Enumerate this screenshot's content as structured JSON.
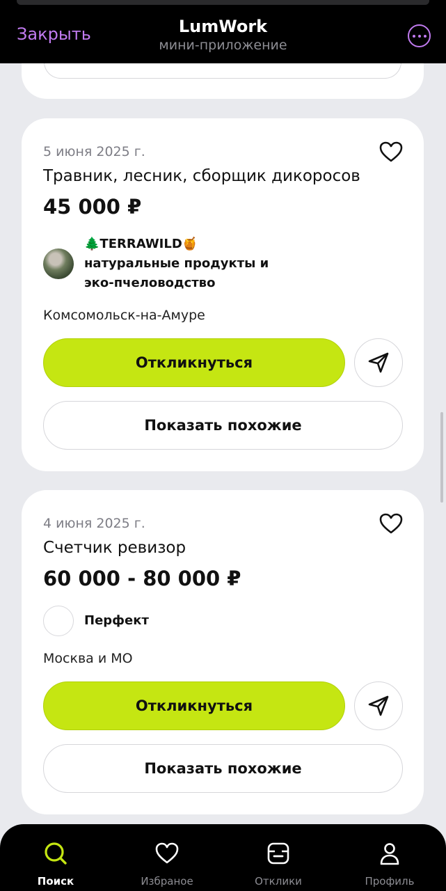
{
  "header": {
    "close_label": "Закрыть",
    "title": "LumWork",
    "subtitle": "мини-приложение",
    "more_icon": "more-icon",
    "accent_color": "#c17bf0"
  },
  "jobs": [
    {
      "date": "5 июня 2025 г.",
      "title": "Травник, лесник, сборщик дикоросов",
      "salary": "45 000 ₽",
      "company_line1": "🌲TERRAWILD🍯",
      "company_line2": "натуральные продукты и эко-пчеловодство",
      "location": "Комсомольск-на-Амуре",
      "apply_label": "Откликнуться",
      "similar_label": "Показать похожие"
    },
    {
      "date": "4 июня 2025 г.",
      "title": "Счетчик ревизор",
      "salary": "60 000 - 80 000 ₽",
      "company_line1": "Перфект",
      "location": "Москва и МО",
      "apply_label": "Откликнуться",
      "similar_label": "Показать похожие"
    }
  ],
  "tabs": [
    {
      "label": "Поиск",
      "icon": "search-icon",
      "active": true
    },
    {
      "label": "Избраное",
      "icon": "heart-icon",
      "active": false
    },
    {
      "label": "Отклики",
      "icon": "responses-icon",
      "active": false
    },
    {
      "label": "Профиль",
      "icon": "profile-icon",
      "active": false
    }
  ],
  "colors": {
    "apply_button": "#c5e612",
    "active_tab_icon": "#c5e612"
  }
}
